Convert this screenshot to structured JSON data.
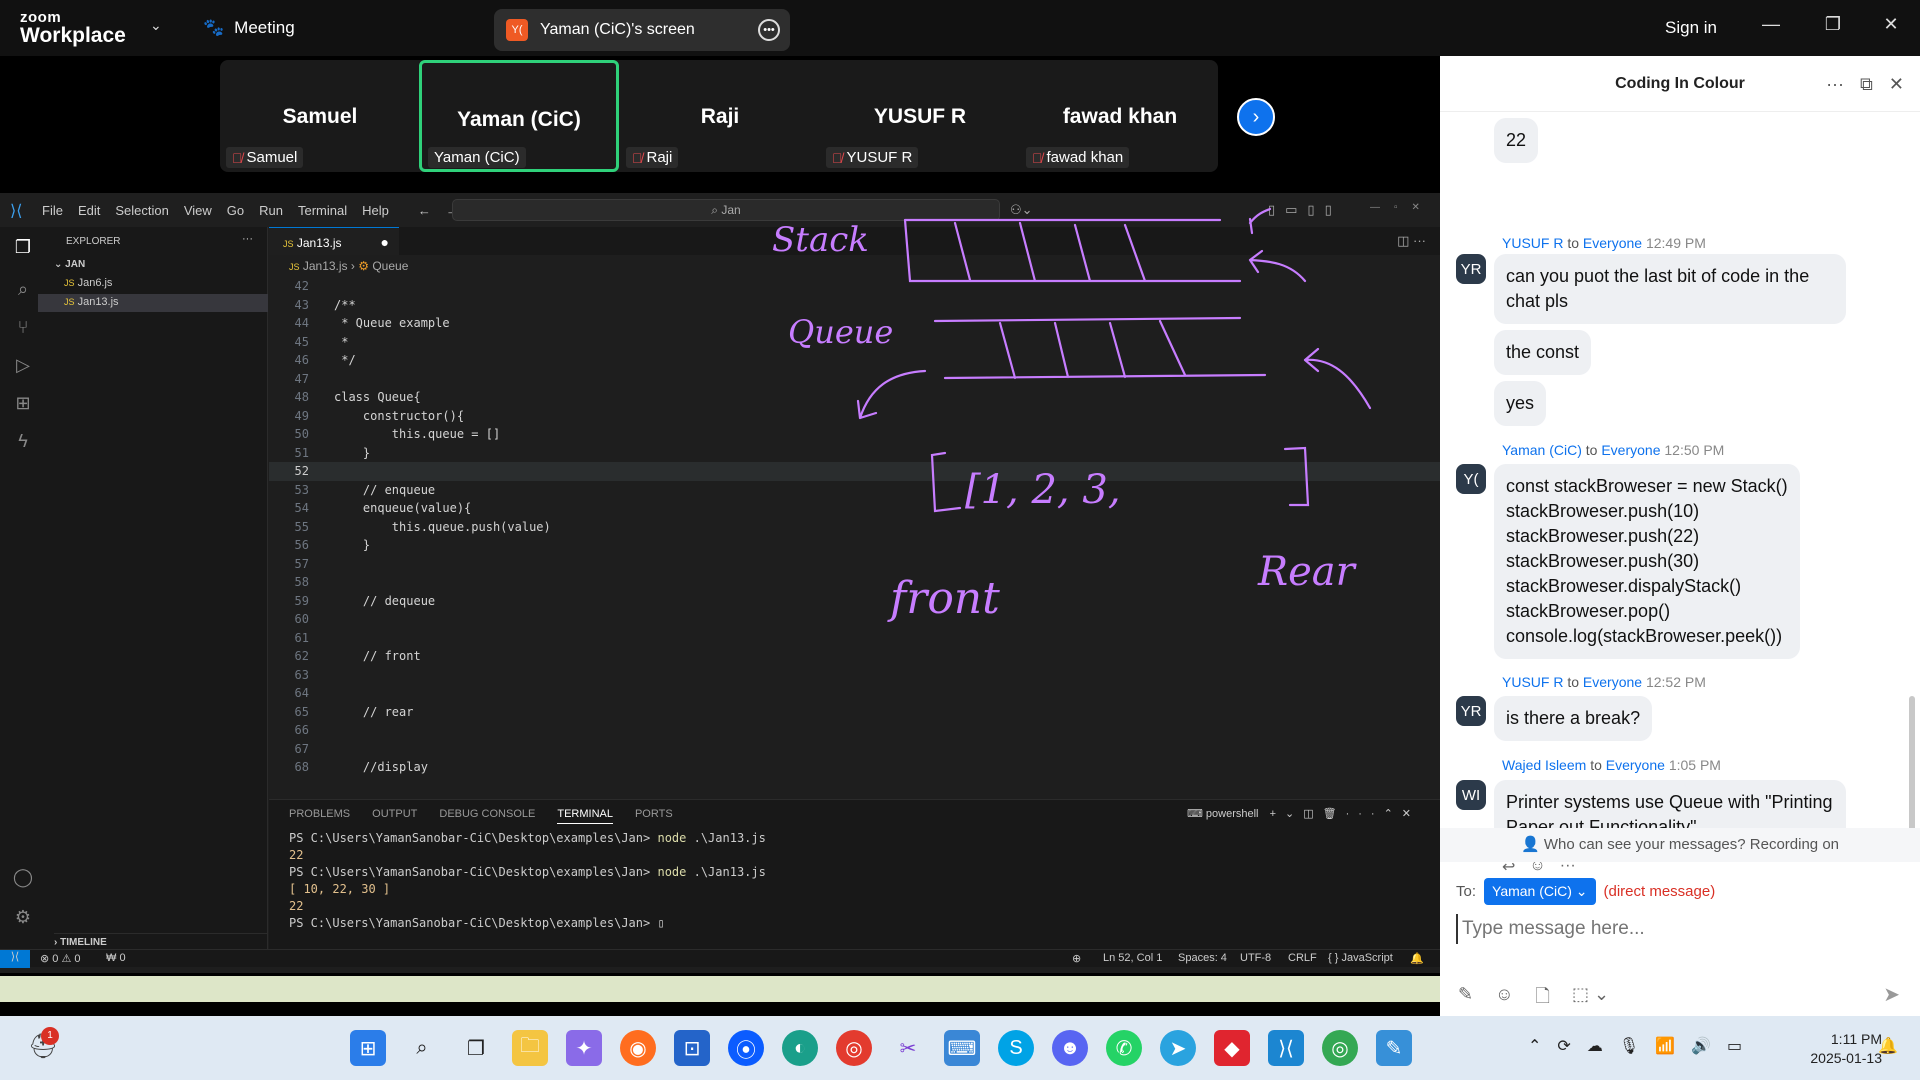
{
  "zoom": {
    "logo_line1": "zoom",
    "logo_line2": "Workplace",
    "meeting_label": "Meeting",
    "screen_share_label": "Yaman (CiC)'s screen",
    "screen_share_avatar": "Y(",
    "sign_in": "Sign in"
  },
  "participants": [
    {
      "name": "Samuel",
      "label": "Samuel",
      "muted": true
    },
    {
      "name": "Yaman (CiC)",
      "label": "Yaman (CiC)",
      "muted": false,
      "active": true
    },
    {
      "name": "Raji",
      "label": "Raji",
      "muted": true
    },
    {
      "name": "YUSUF R",
      "label": "YUSUF R",
      "muted": true
    },
    {
      "name": "fawad khan",
      "label": "fawad khan",
      "muted": true
    }
  ],
  "vscode": {
    "menu": [
      "File",
      "Edit",
      "Selection",
      "View",
      "Go",
      "Run",
      "Terminal",
      "Help"
    ],
    "search": "Jan",
    "explorer_title": "EXPLORER",
    "folder": "JAN",
    "files": [
      "Jan6.js",
      "Jan13.js"
    ],
    "timeline": "TIMELINE",
    "tab_label": "Jan13.js",
    "breadcrumb_file": "Jan13.js",
    "breadcrumb_symbol": "Queue",
    "code_lines": [
      {
        "n": "42",
        "t": ""
      },
      {
        "n": "43",
        "t": "/**"
      },
      {
        "n": "44",
        "t": " * Queue example"
      },
      {
        "n": "45",
        "t": " *"
      },
      {
        "n": "46",
        "t": " */"
      },
      {
        "n": "47",
        "t": ""
      },
      {
        "n": "48",
        "t": "class Queue{"
      },
      {
        "n": "49",
        "t": "    constructor(){"
      },
      {
        "n": "50",
        "t": "        this.queue = []"
      },
      {
        "n": "51",
        "t": "    }"
      },
      {
        "n": "52",
        "t": ""
      },
      {
        "n": "53",
        "t": "    // enqueue"
      },
      {
        "n": "54",
        "t": "    enqueue(value){"
      },
      {
        "n": "55",
        "t": "        this.queue.push(value)"
      },
      {
        "n": "56",
        "t": "    }"
      },
      {
        "n": "57",
        "t": ""
      },
      {
        "n": "58",
        "t": ""
      },
      {
        "n": "59",
        "t": "    // dequeue"
      },
      {
        "n": "60",
        "t": ""
      },
      {
        "n": "61",
        "t": ""
      },
      {
        "n": "62",
        "t": "    // front"
      },
      {
        "n": "63",
        "t": ""
      },
      {
        "n": "64",
        "t": ""
      },
      {
        "n": "65",
        "t": "    // rear"
      },
      {
        "n": "66",
        "t": ""
      },
      {
        "n": "67",
        "t": ""
      },
      {
        "n": "68",
        "t": "    //display"
      }
    ],
    "annotations": [
      "Stack",
      "Queue",
      "[1, 2, 3,",
      "]",
      "front",
      "Rear"
    ],
    "terminal_tabs": [
      "PROBLEMS",
      "OUTPUT",
      "DEBUG CONSOLE",
      "TERMINAL",
      "PORTS"
    ],
    "terminal_shell": "powershell",
    "terminal_lines": [
      {
        "prompt": "PS C:\\Users\\YamanSanobar-CiC\\Desktop\\examples\\Jan> ",
        "cmd": "node",
        "arg": " .\\Jan13.js"
      },
      {
        "out": "22"
      },
      {
        "prompt": "PS C:\\Users\\YamanSanobar-CiC\\Desktop\\examples\\Jan> ",
        "cmd": "node",
        "arg": " .\\Jan13.js"
      },
      {
        "out": "[ 10, 22, 30 ]"
      },
      {
        "out": "22"
      },
      {
        "prompt": "PS C:\\Users\\YamanSanobar-CiC\\Desktop\\examples\\Jan> ",
        "cmd": "",
        "arg": ""
      }
    ],
    "status": {
      "problems": "⊗ 0 ⚠ 0",
      "ports": "₩ 0",
      "position": "Ln 52, Col 1",
      "spaces": "Spaces: 4",
      "encoding": "UTF-8",
      "eol": "CRLF",
      "language": "JavaScript"
    }
  },
  "chat": {
    "title": "Coding In Colour",
    "messages": [
      {
        "bubble": "22"
      },
      {
        "sender": "YUSUF R",
        "to": "to",
        "audience": "Everyone",
        "time": "12:49 PM",
        "avatar": "YR",
        "bubble": "can you puot the last bit of code in the chat pls"
      },
      {
        "bubble": "the const"
      },
      {
        "bubble": "yes"
      },
      {
        "sender": "Yaman (CiC)",
        "to": "to",
        "audience": "Everyone",
        "time": "12:50 PM",
        "avatar": "Y(",
        "code": [
          "const stackBroweser = new Stack()",
          "stackBroweser.push(10)",
          "stackBroweser.push(22)",
          "stackBroweser.push(30)",
          "stackBroweser.dispalyStack()",
          "stackBroweser.pop()",
          "console.log(stackBroweser.peek())"
        ]
      },
      {
        "sender": "YUSUF R",
        "to": "to",
        "audience": "Everyone",
        "time": "12:52 PM",
        "avatar": "YR",
        "bubble": "is there a break?"
      },
      {
        "sender": "Wajed Isleem",
        "to": "to",
        "audience": "Everyone",
        "time": "1:05 PM",
        "avatar": "WI",
        "bubble": "Printer systems use Queue with \"Printing Paper out Functionality\""
      }
    ],
    "who_can_see": "Who can see your messages? Recording on",
    "to_label": "To:",
    "recipient": "Yaman (CiC) ⌄",
    "direct": "(direct message)",
    "placeholder": "Type message here..."
  },
  "taskbar": {
    "notif_count": "1",
    "time": "1:11 PM",
    "date": "2025-01-13"
  }
}
